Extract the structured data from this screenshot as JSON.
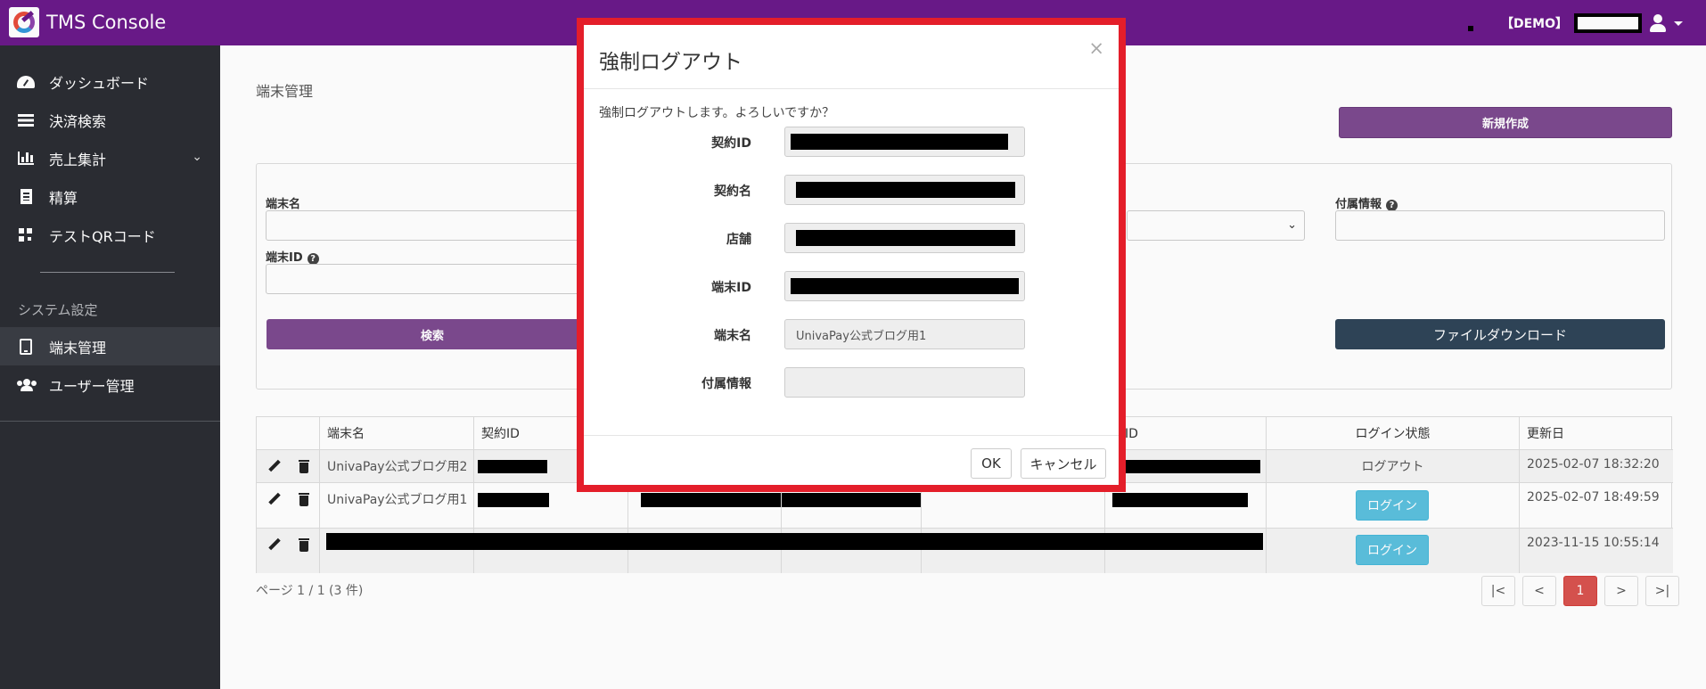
{
  "app": {
    "title": "TMS Console"
  },
  "topbar": {
    "env_label": "【DEMO】"
  },
  "sidebar": {
    "items": [
      {
        "label": "ダッシュボード",
        "icon": "dashboard-icon"
      },
      {
        "label": "決済検索",
        "icon": "list-icon"
      },
      {
        "label": "売上集計",
        "icon": "bar-chart-icon"
      },
      {
        "label": "精算",
        "icon": "receipt-icon"
      },
      {
        "label": "テストQRコード",
        "icon": "qrcode-icon"
      }
    ],
    "section_title": "システム設定",
    "settings_items": [
      {
        "label": "端末管理",
        "icon": "tablet-icon",
        "active": true
      },
      {
        "label": "ユーザー管理",
        "icon": "users-icon"
      }
    ]
  },
  "main": {
    "page_title": "端末管理",
    "new_button": "新規作成",
    "filters": {
      "terminal_name_label": "端末名",
      "terminal_id_label": "端末ID",
      "attached_info_label": "付属情報",
      "search_button": "検索",
      "download_button": "ファイルダウンロード"
    },
    "table": {
      "headers": [
        "端末名",
        "契約ID",
        "末ID",
        "ログイン状態",
        "更新日"
      ],
      "rows": [
        {
          "name": "UnivaPay公式ブログ用2",
          "status": "ログアウト",
          "updated": "2025-02-07 18:32:20"
        },
        {
          "name": "UnivaPay公式ブログ用1",
          "status": "ログイン",
          "updated": "2025-02-07 18:49:59"
        },
        {
          "name": "",
          "status": "ログイン",
          "updated": "2023-11-15 10:55:14"
        }
      ]
    },
    "page_info": "ページ 1 / 1 (3 件)",
    "pager": {
      "first": "|<",
      "prev": "<",
      "current": "1",
      "next": ">",
      "last": ">|"
    }
  },
  "modal": {
    "title": "強制ログアウト",
    "close": "×",
    "message": "強制ログアウトします。よろしいですか？",
    "fields": {
      "contract_id_label": "契約ID",
      "contract_name_label": "契約名",
      "store_label": "店舗",
      "terminal_id_label": "端末ID",
      "terminal_name_label": "端末名",
      "terminal_name_value": "UnivaPay公式ブログ用1",
      "attached_info_label": "付属情報",
      "attached_info_value": ""
    },
    "ok": "OK",
    "cancel": "キャンセル"
  },
  "colors": {
    "topbar": "#6b1a8a",
    "sidebar": "#2b2d33",
    "primary_button": "#7d4a8f",
    "download_button": "#2f4558",
    "login_button": "#5bc0de",
    "pager_active": "#d9534f",
    "modal_highlight": "#e41e2a"
  }
}
